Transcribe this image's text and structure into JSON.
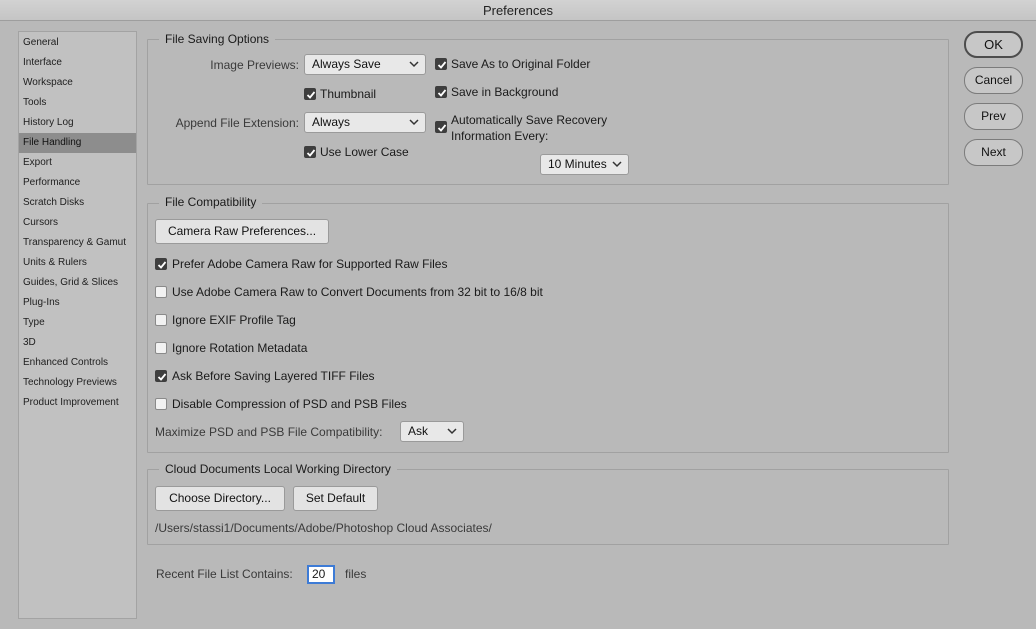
{
  "window": {
    "title": "Preferences"
  },
  "sidebar": {
    "items": [
      {
        "label": "General"
      },
      {
        "label": "Interface"
      },
      {
        "label": "Workspace"
      },
      {
        "label": "Tools"
      },
      {
        "label": "History Log"
      },
      {
        "label": "File Handling"
      },
      {
        "label": "Export"
      },
      {
        "label": "Performance"
      },
      {
        "label": "Scratch Disks"
      },
      {
        "label": "Cursors"
      },
      {
        "label": "Transparency & Gamut"
      },
      {
        "label": "Units & Rulers"
      },
      {
        "label": "Guides, Grid & Slices"
      },
      {
        "label": "Plug-Ins"
      },
      {
        "label": "Type"
      },
      {
        "label": "3D"
      },
      {
        "label": "Enhanced Controls"
      },
      {
        "label": "Technology Previews"
      },
      {
        "label": "Product Improvement"
      }
    ],
    "selected": "File Handling"
  },
  "file_saving": {
    "title": "File Saving Options",
    "image_previews_label": "Image Previews:",
    "image_previews_value": "Always Save",
    "thumbnail_label": "Thumbnail",
    "thumbnail_checked": true,
    "append_ext_label": "Append File Extension:",
    "append_ext_value": "Always",
    "lower_case_label": "Use Lower Case",
    "lower_case_checked": true,
    "save_original_label": "Save As to Original Folder",
    "save_original_checked": true,
    "save_background_label": "Save in Background",
    "save_background_checked": true,
    "auto_save_label_1": "Automatically Save Recovery",
    "auto_save_label_2": "Information Every:",
    "auto_save_checked": true,
    "auto_save_interval": "10 Minutes"
  },
  "file_compat": {
    "title": "File Compatibility",
    "camera_raw_button": "Camera Raw Preferences...",
    "options": [
      {
        "label": "Prefer Adobe Camera Raw for Supported Raw Files",
        "checked": true
      },
      {
        "label": "Use Adobe Camera Raw to Convert Documents from 32 bit to 16/8 bit",
        "checked": false
      },
      {
        "label": "Ignore EXIF Profile Tag",
        "checked": false
      },
      {
        "label": "Ignore Rotation Metadata",
        "checked": false
      },
      {
        "label": "Ask Before Saving Layered TIFF Files",
        "checked": true
      },
      {
        "label": "Disable Compression of PSD and PSB Files",
        "checked": false
      }
    ],
    "maximize_label": "Maximize PSD and PSB File Compatibility:",
    "maximize_value": "Ask"
  },
  "cloud_docs": {
    "title": "Cloud Documents Local Working Directory",
    "choose_button": "Choose Directory...",
    "default_button": "Set Default",
    "path": "/Users/stassi1/Documents/Adobe/Photoshop Cloud Associates/"
  },
  "recent": {
    "label": "Recent File List Contains:",
    "value": "20",
    "suffix": "files"
  },
  "buttons": {
    "ok": "OK",
    "cancel": "Cancel",
    "prev": "Prev",
    "next": "Next"
  },
  "colors": {
    "background": "#b9b9b9",
    "selected_item": "#8d8d8d",
    "focus_ring": "#3d7bd6"
  }
}
